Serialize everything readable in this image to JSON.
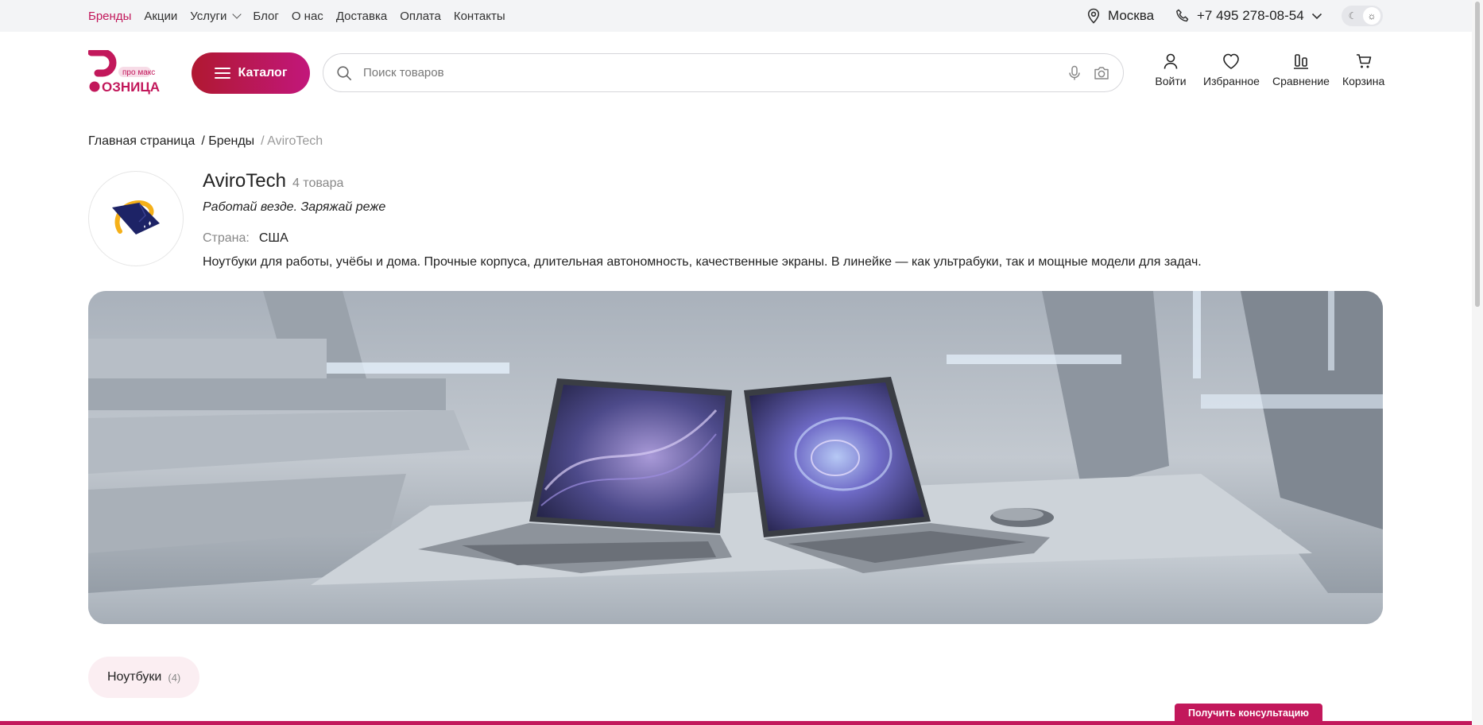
{
  "topnav": {
    "items": [
      "Бренды",
      "Акции",
      "Услуги",
      "Блог",
      "О нас",
      "Доставка",
      "Оплата",
      "Контакты"
    ],
    "city": "Москва",
    "phone": "+7 495 278-08-54"
  },
  "logo": {
    "line1": "про макс",
    "line2": "ОЗНИЦА"
  },
  "header": {
    "catalog_label": "Каталог",
    "search_placeholder": "Поиск товаров",
    "actions": [
      "Войти",
      "Избранное",
      "Сравнение",
      "Корзина"
    ]
  },
  "breadcrumb": {
    "home": "Главная страница",
    "brands": "/ Бренды",
    "current": "/ AviroTech"
  },
  "brand": {
    "name": "AviroTech",
    "count": "4 товара",
    "slogan": "Работай везде. Заряжай реже",
    "country_label": "Страна:",
    "country": "США",
    "description": "Ноутбуки для работы, учёбы и дома. Прочные корпуса, длительная автономность, качественные экраны. В линейке — как ультрабуки, так и мощные модели для задач."
  },
  "tabs": [
    {
      "label": "Ноутбуки",
      "count": "(4)"
    }
  ],
  "consult_label": "Получить консультацию",
  "colors": {
    "accent": "#c2185b",
    "catalog_start": "#b01831",
    "catalog_end": "#c2177b"
  }
}
